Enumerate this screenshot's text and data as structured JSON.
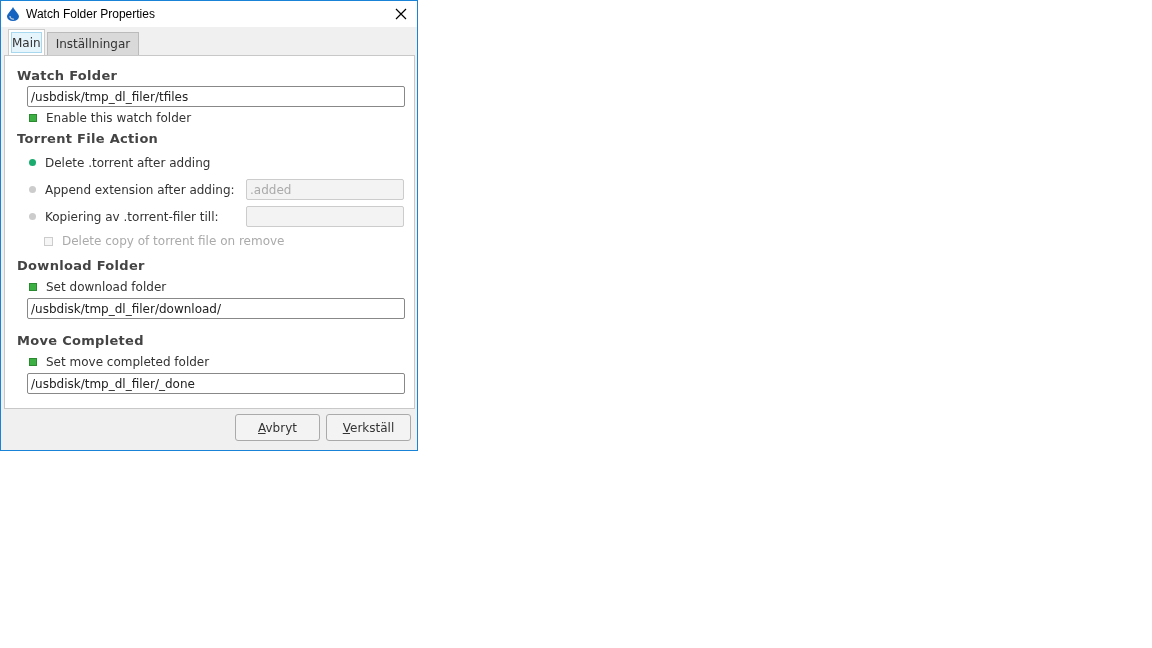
{
  "window": {
    "title": "Watch Folder Properties"
  },
  "tabs": [
    {
      "label": "Main",
      "selected": true
    },
    {
      "label": "Inställningar",
      "selected": false
    }
  ],
  "watch_folder": {
    "heading": "Watch Folder",
    "path": "/usbdisk/tmp_dl_filer/tfiles",
    "enable": {
      "label": "Enable this watch folder",
      "checked": true
    }
  },
  "torrent_file_action": {
    "heading": "Torrent File Action",
    "options": [
      {
        "label": "Delete .torrent after adding",
        "selected": true
      },
      {
        "label": "Append extension after adding:",
        "selected": false,
        "field": {
          "value": ".added",
          "disabled": true
        }
      },
      {
        "label": "Kopiering av .torrent-filer till:",
        "selected": false,
        "field": {
          "disabled": true
        }
      }
    ],
    "delete_copy": {
      "label": "Delete copy of torrent file on remove",
      "checked": false,
      "disabled": true
    }
  },
  "download_folder": {
    "heading": "Download Folder",
    "checkbox": {
      "label": "Set download folder",
      "checked": true
    },
    "path": "/usbdisk/tmp_dl_filer/download/"
  },
  "move_completed": {
    "heading": "Move Completed",
    "checkbox": {
      "label": "Set move completed folder",
      "checked": true
    },
    "path": "/usbdisk/tmp_dl_filer/_done"
  },
  "buttons": [
    "Avbryt",
    "Verkställ"
  ]
}
